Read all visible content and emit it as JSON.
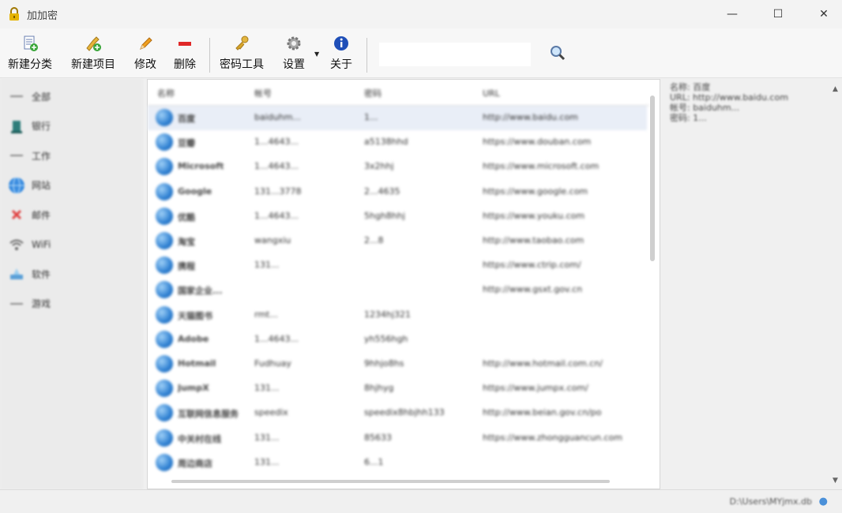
{
  "window": {
    "title": "加加密",
    "minimize": "—",
    "maximize": "☐",
    "close": "✕"
  },
  "toolbar": {
    "new_category": "新建分类",
    "new_item": "新建项目",
    "edit": "修改",
    "delete": "删除",
    "password_tool": "密码工具",
    "settings": "设置",
    "about": "关于",
    "search_placeholder": ""
  },
  "categories": [
    {
      "label": "全部",
      "icon": "dash-icon"
    },
    {
      "label": "银行",
      "icon": "bank-icon"
    },
    {
      "label": "工作",
      "icon": "dash-icon"
    },
    {
      "label": "网站",
      "icon": "globe-icon"
    },
    {
      "label": "邮件",
      "icon": "mail-icon"
    },
    {
      "label": "WiFi",
      "icon": "wifi-icon"
    },
    {
      "label": "软件",
      "icon": "software-icon"
    },
    {
      "label": "游戏",
      "icon": "dash-icon"
    }
  ],
  "columns": {
    "name": "名称",
    "account": "帐号",
    "password": "密码",
    "url": "URL"
  },
  "rows": [
    {
      "name": "百度",
      "account": "baiduhm...",
      "password": "1...",
      "url": "http://www.baidu.com"
    },
    {
      "name": "豆瓣",
      "account": "1...4643...",
      "password": "a5138hhd",
      "url": "https://www.douban.com"
    },
    {
      "name": "Microsoft",
      "account": "1...4643...",
      "password": "3x2hhj",
      "url": "https://www.microsoft.com"
    },
    {
      "name": "Google",
      "account": "131...3778",
      "password": "2...4635",
      "url": "https://www.google.com"
    },
    {
      "name": "优酷",
      "account": "1...4643...",
      "password": "5hgh8hhj",
      "url": "https://www.youku.com"
    },
    {
      "name": "淘宝",
      "account": "wangxiu",
      "password": "2...8",
      "url": "http://www.taobao.com"
    },
    {
      "name": "携程",
      "account": "131...",
      "password": "",
      "url": "https://www.ctrip.com/"
    },
    {
      "name": "国家企业...",
      "account": "",
      "password": "",
      "url": "http://www.gsxt.gov.cn"
    },
    {
      "name": "天猫图书",
      "account": "rmt...",
      "password": "1234hj321",
      "url": ""
    },
    {
      "name": "Adobe",
      "account": "1...4643...",
      "password": "yh556hgh",
      "url": ""
    },
    {
      "name": "Hotmail",
      "account": "Fudhuay",
      "password": "9hhjo8hs",
      "url": "http://www.hotmail.com.cn/"
    },
    {
      "name": "JumpX",
      "account": "131...",
      "password": "8hjhyg",
      "url": "https://www.jumpx.com/"
    },
    {
      "name": "互联网信息服务",
      "account": "speedix",
      "password": "speedix8hbjhh133",
      "url": "http://www.beian.gov.cn/po"
    },
    {
      "name": "中关村在线",
      "account": "131...",
      "password": "85633",
      "url": "https://www.zhongguancun.com"
    },
    {
      "name": "周边商店",
      "account": "131...",
      "password": "6...1",
      "url": ""
    }
  ],
  "detail": {
    "name_line": "名称: 百度",
    "url_line": "URL: http://www.baidu.com",
    "account_line": "帐号: baiduhm...",
    "password_line": "密码: 1..."
  },
  "status": {
    "path": "D:\\Users\\MYjmx.db"
  }
}
